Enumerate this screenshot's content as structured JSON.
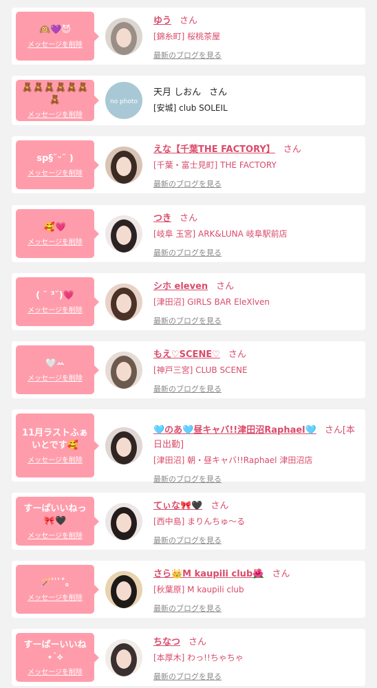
{
  "delete_label": "メッセージを削除",
  "san_label": "さん",
  "blog_label": "最新のブログを見る",
  "colors": {
    "accent_pink": "#ff9cab",
    "name_pink": "#d94b6a",
    "blog_gray": "#888888",
    "background": "#f2f2f2"
  },
  "items": [
    {
      "message": "🙉💜😈",
      "name": "ゆう",
      "shop": "[錦糸町] 桜桃茶屋",
      "blog": true,
      "linked": true,
      "avatar": "cat-mask-avatar"
    },
    {
      "message": "🧸🧸🧸🧸🧸🧸🧸",
      "name": "天月 しおん",
      "shop": "[安城] club SOLEIL",
      "blog": false,
      "linked": false,
      "avatar": "no-photo-avatar",
      "avatar_text": "no photo"
    },
    {
      "message": "sp§˘ᵕ˘ )",
      "name": "えな【千葉THE FACTORY】",
      "shop": "[千葉・富士見町] THE FACTORY",
      "blog": true,
      "linked": true,
      "avatar": "portrait-avatar"
    },
    {
      "message": "🥰💗",
      "name": "つき",
      "shop": "[岐阜 玉宮] ARK&LUNA 岐阜駅前店",
      "blog": true,
      "linked": true,
      "avatar": "portrait-avatar"
    },
    {
      "message": "( ˘ ³˘)💗",
      "name": "シホ eleven",
      "shop": "[津田沼] GIRLS BAR EleXlven",
      "blog": true,
      "linked": true,
      "avatar": "portrait-avatar"
    },
    {
      "message": "🤍ꕀ",
      "name": "もえ♡SCENE♡",
      "shop": "[神戸三宮] CLUB SCENE",
      "blog": true,
      "linked": true,
      "avatar": "portrait-avatar"
    },
    {
      "message": "11月ラストふぁいとです🥰",
      "name": "🩵のあ🩵昼キャバ!!津田沼Raphael🩵",
      "shop": "[津田沼] 朝・昼キャバ!!Raphael 津田沼店",
      "blog": true,
      "linked": true,
      "avatar": "portrait-avatar",
      "name_suffix": "さん[本日出勤]"
    },
    {
      "message": "すーぱいいねっ🎀🖤",
      "name": "てぃな🎀🖤",
      "shop": "[西中島] まりんちゅ～る",
      "blog": true,
      "linked": true,
      "avatar": "portrait-avatar"
    },
    {
      "message": "🪄 ͗ ͗ ͗˚｡",
      "name": "さら👑M kaupili club🌺",
      "shop": "[秋葉原] M kaupili club",
      "blog": true,
      "linked": true,
      "avatar": "panda-avatar"
    },
    {
      "message": "すーぱーいいね ⋆˙⟡",
      "name": "ちなつ",
      "shop": "[本厚木] わっ!!ちゃちゃ",
      "blog": true,
      "linked": true,
      "avatar": "portrait-avatar"
    }
  ]
}
